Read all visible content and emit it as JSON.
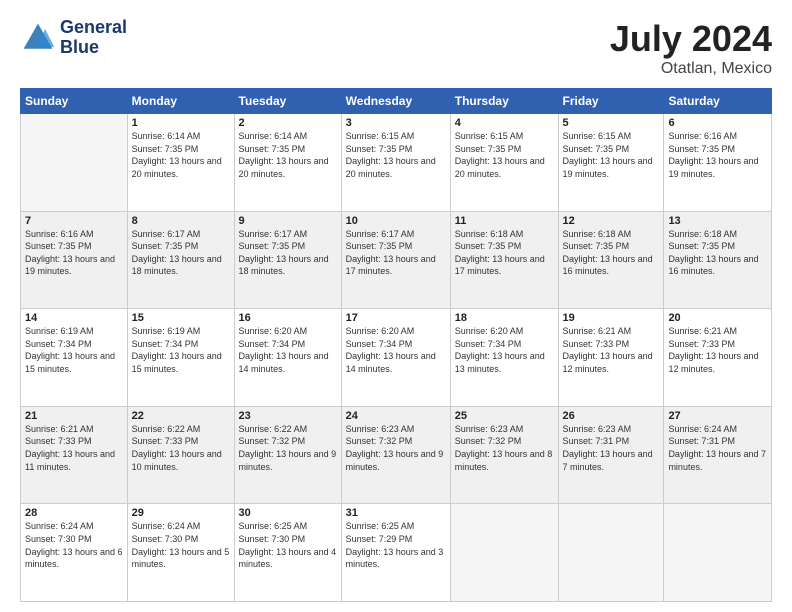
{
  "logo": {
    "line1": "General",
    "line2": "Blue"
  },
  "title": "July 2024",
  "subtitle": "Otatlan, Mexico",
  "days_of_week": [
    "Sunday",
    "Monday",
    "Tuesday",
    "Wednesday",
    "Thursday",
    "Friday",
    "Saturday"
  ],
  "weeks": [
    [
      {
        "day": "",
        "sunrise": "",
        "sunset": "",
        "daylight": "",
        "empty": true
      },
      {
        "day": "1",
        "sunrise": "Sunrise: 6:14 AM",
        "sunset": "Sunset: 7:35 PM",
        "daylight": "Daylight: 13 hours and 20 minutes."
      },
      {
        "day": "2",
        "sunrise": "Sunrise: 6:14 AM",
        "sunset": "Sunset: 7:35 PM",
        "daylight": "Daylight: 13 hours and 20 minutes."
      },
      {
        "day": "3",
        "sunrise": "Sunrise: 6:15 AM",
        "sunset": "Sunset: 7:35 PM",
        "daylight": "Daylight: 13 hours and 20 minutes."
      },
      {
        "day": "4",
        "sunrise": "Sunrise: 6:15 AM",
        "sunset": "Sunset: 7:35 PM",
        "daylight": "Daylight: 13 hours and 20 minutes."
      },
      {
        "day": "5",
        "sunrise": "Sunrise: 6:15 AM",
        "sunset": "Sunset: 7:35 PM",
        "daylight": "Daylight: 13 hours and 19 minutes."
      },
      {
        "day": "6",
        "sunrise": "Sunrise: 6:16 AM",
        "sunset": "Sunset: 7:35 PM",
        "daylight": "Daylight: 13 hours and 19 minutes."
      }
    ],
    [
      {
        "day": "7",
        "sunrise": "Sunrise: 6:16 AM",
        "sunset": "Sunset: 7:35 PM",
        "daylight": "Daylight: 13 hours and 19 minutes."
      },
      {
        "day": "8",
        "sunrise": "Sunrise: 6:17 AM",
        "sunset": "Sunset: 7:35 PM",
        "daylight": "Daylight: 13 hours and 18 minutes."
      },
      {
        "day": "9",
        "sunrise": "Sunrise: 6:17 AM",
        "sunset": "Sunset: 7:35 PM",
        "daylight": "Daylight: 13 hours and 18 minutes."
      },
      {
        "day": "10",
        "sunrise": "Sunrise: 6:17 AM",
        "sunset": "Sunset: 7:35 PM",
        "daylight": "Daylight: 13 hours and 17 minutes."
      },
      {
        "day": "11",
        "sunrise": "Sunrise: 6:18 AM",
        "sunset": "Sunset: 7:35 PM",
        "daylight": "Daylight: 13 hours and 17 minutes."
      },
      {
        "day": "12",
        "sunrise": "Sunrise: 6:18 AM",
        "sunset": "Sunset: 7:35 PM",
        "daylight": "Daylight: 13 hours and 16 minutes."
      },
      {
        "day": "13",
        "sunrise": "Sunrise: 6:18 AM",
        "sunset": "Sunset: 7:35 PM",
        "daylight": "Daylight: 13 hours and 16 minutes."
      }
    ],
    [
      {
        "day": "14",
        "sunrise": "Sunrise: 6:19 AM",
        "sunset": "Sunset: 7:34 PM",
        "daylight": "Daylight: 13 hours and 15 minutes."
      },
      {
        "day": "15",
        "sunrise": "Sunrise: 6:19 AM",
        "sunset": "Sunset: 7:34 PM",
        "daylight": "Daylight: 13 hours and 15 minutes."
      },
      {
        "day": "16",
        "sunrise": "Sunrise: 6:20 AM",
        "sunset": "Sunset: 7:34 PM",
        "daylight": "Daylight: 13 hours and 14 minutes."
      },
      {
        "day": "17",
        "sunrise": "Sunrise: 6:20 AM",
        "sunset": "Sunset: 7:34 PM",
        "daylight": "Daylight: 13 hours and 14 minutes."
      },
      {
        "day": "18",
        "sunrise": "Sunrise: 6:20 AM",
        "sunset": "Sunset: 7:34 PM",
        "daylight": "Daylight: 13 hours and 13 minutes."
      },
      {
        "day": "19",
        "sunrise": "Sunrise: 6:21 AM",
        "sunset": "Sunset: 7:33 PM",
        "daylight": "Daylight: 13 hours and 12 minutes."
      },
      {
        "day": "20",
        "sunrise": "Sunrise: 6:21 AM",
        "sunset": "Sunset: 7:33 PM",
        "daylight": "Daylight: 13 hours and 12 minutes."
      }
    ],
    [
      {
        "day": "21",
        "sunrise": "Sunrise: 6:21 AM",
        "sunset": "Sunset: 7:33 PM",
        "daylight": "Daylight: 13 hours and 11 minutes."
      },
      {
        "day": "22",
        "sunrise": "Sunrise: 6:22 AM",
        "sunset": "Sunset: 7:33 PM",
        "daylight": "Daylight: 13 hours and 10 minutes."
      },
      {
        "day": "23",
        "sunrise": "Sunrise: 6:22 AM",
        "sunset": "Sunset: 7:32 PM",
        "daylight": "Daylight: 13 hours and 9 minutes."
      },
      {
        "day": "24",
        "sunrise": "Sunrise: 6:23 AM",
        "sunset": "Sunset: 7:32 PM",
        "daylight": "Daylight: 13 hours and 9 minutes."
      },
      {
        "day": "25",
        "sunrise": "Sunrise: 6:23 AM",
        "sunset": "Sunset: 7:32 PM",
        "daylight": "Daylight: 13 hours and 8 minutes."
      },
      {
        "day": "26",
        "sunrise": "Sunrise: 6:23 AM",
        "sunset": "Sunset: 7:31 PM",
        "daylight": "Daylight: 13 hours and 7 minutes."
      },
      {
        "day": "27",
        "sunrise": "Sunrise: 6:24 AM",
        "sunset": "Sunset: 7:31 PM",
        "daylight": "Daylight: 13 hours and 7 minutes."
      }
    ],
    [
      {
        "day": "28",
        "sunrise": "Sunrise: 6:24 AM",
        "sunset": "Sunset: 7:30 PM",
        "daylight": "Daylight: 13 hours and 6 minutes."
      },
      {
        "day": "29",
        "sunrise": "Sunrise: 6:24 AM",
        "sunset": "Sunset: 7:30 PM",
        "daylight": "Daylight: 13 hours and 5 minutes."
      },
      {
        "day": "30",
        "sunrise": "Sunrise: 6:25 AM",
        "sunset": "Sunset: 7:30 PM",
        "daylight": "Daylight: 13 hours and 4 minutes."
      },
      {
        "day": "31",
        "sunrise": "Sunrise: 6:25 AM",
        "sunset": "Sunset: 7:29 PM",
        "daylight": "Daylight: 13 hours and 3 minutes."
      },
      {
        "day": "",
        "sunrise": "",
        "sunset": "",
        "daylight": "",
        "empty": true
      },
      {
        "day": "",
        "sunrise": "",
        "sunset": "",
        "daylight": "",
        "empty": true
      },
      {
        "day": "",
        "sunrise": "",
        "sunset": "",
        "daylight": "",
        "empty": true
      }
    ]
  ]
}
